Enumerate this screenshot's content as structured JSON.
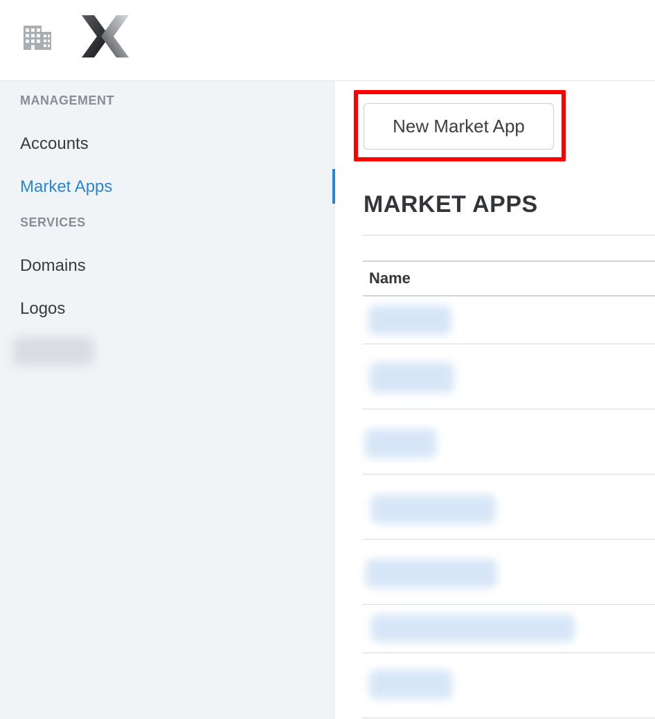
{
  "header": {
    "org_icon": "building-icon",
    "logo": "x-brand-logo"
  },
  "sidebar": {
    "sections": [
      {
        "heading": "MANAGEMENT",
        "items": [
          {
            "label": "Accounts",
            "active": false
          },
          {
            "label": "Market Apps",
            "active": true
          }
        ]
      },
      {
        "heading": "SERVICES",
        "items": [
          {
            "label": "Domains",
            "active": false
          },
          {
            "label": "Logos",
            "active": false
          }
        ]
      }
    ],
    "blurred_item": "redacted"
  },
  "main": {
    "new_button_label": "New Market App",
    "title": "MARKET APPS",
    "table": {
      "columns": [
        "Name"
      ],
      "rows": [
        {
          "name": "redacted"
        },
        {
          "name": "redacted"
        },
        {
          "name": "redacted"
        },
        {
          "name": "redacted"
        },
        {
          "name": "redacted"
        },
        {
          "name": "redacted"
        },
        {
          "name": "redacted"
        }
      ]
    }
  },
  "colors": {
    "accent": "#2a85d6",
    "highlight": "#ff0000",
    "sidebar_bg": "#f1f4f7"
  }
}
